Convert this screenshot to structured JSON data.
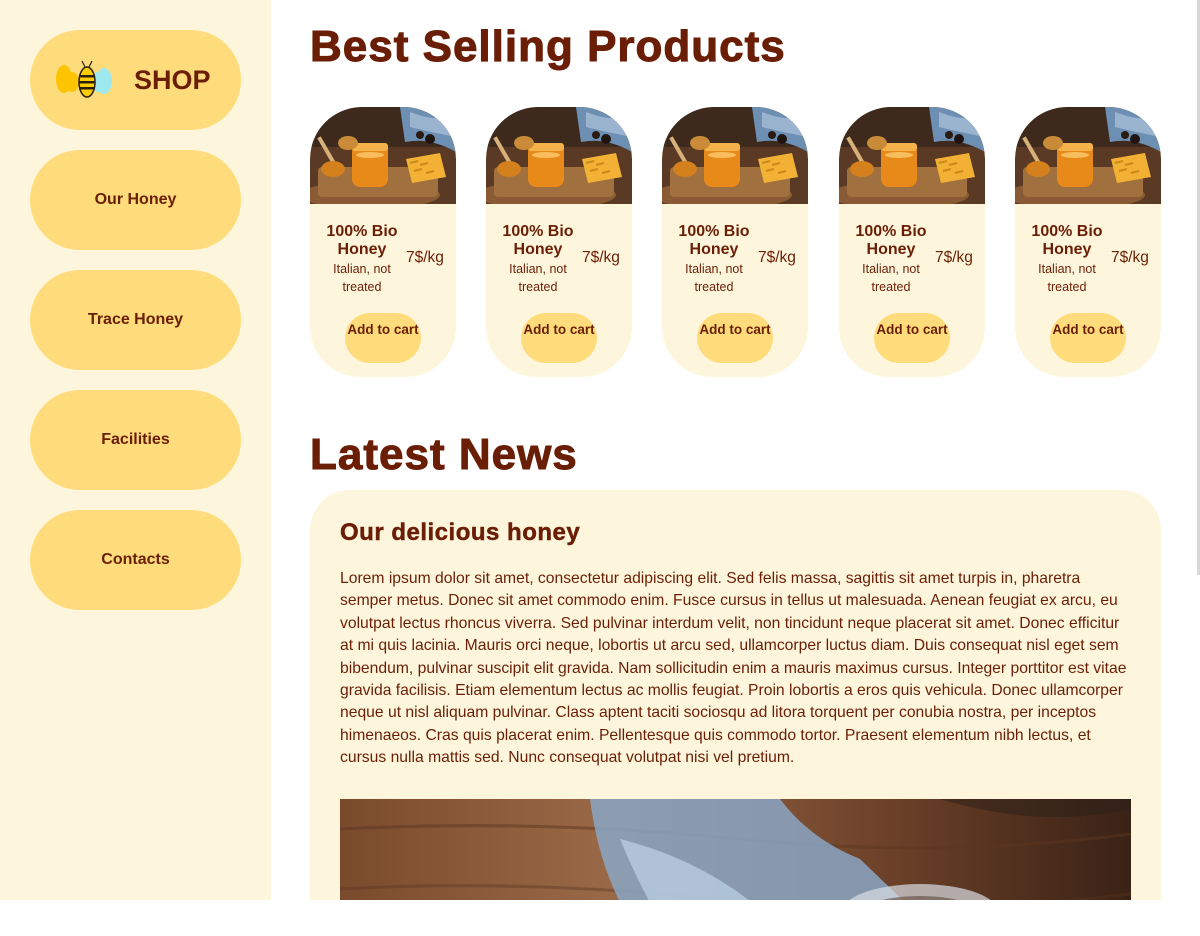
{
  "sidebar": {
    "logo_text": "SHOP",
    "items": [
      {
        "label": "Our Honey"
      },
      {
        "label": "Trace Honey"
      },
      {
        "label": "Facilities"
      },
      {
        "label": "Contacts"
      }
    ]
  },
  "best_selling": {
    "title": "Best Selling Products",
    "products": [
      {
        "name": "100% Bio Honey",
        "subtitle": "Italian, not treated",
        "price": "7$/kg",
        "button": "Add to cart"
      },
      {
        "name": "100% Bio Honey",
        "subtitle": "Italian, not treated",
        "price": "7$/kg",
        "button": "Add to cart"
      },
      {
        "name": "100% Bio Honey",
        "subtitle": "Italian, not treated",
        "price": "7$/kg",
        "button": "Add to cart"
      },
      {
        "name": "100% Bio Honey",
        "subtitle": "Italian, not treated",
        "price": "7$/kg",
        "button": "Add to cart"
      },
      {
        "name": "100% Bio Honey",
        "subtitle": "Italian, not treated",
        "price": "7$/kg",
        "button": "Add to cart"
      }
    ]
  },
  "news": {
    "title": "Latest News",
    "article": {
      "heading": "Our delicious honey",
      "body": "Lorem ipsum dolor sit amet, consectetur adipiscing elit. Sed felis massa, sagittis sit amet turpis in, pharetra semper metus. Donec sit amet commodo enim. Fusce cursus in tellus ut malesuada. Aenean feugiat ex arcu, eu volutpat lectus rhoncus viverra. Sed pulvinar interdum velit, non tincidunt neque placerat sit amet. Donec efficitur at mi quis lacinia. Mauris orci neque, lobortis ut arcu sed, ullamcorper luctus diam. Duis consequat nisl eget sem bibendum, pulvinar suscipit elit gravida. Nam sollicitudin enim a mauris maximus cursus. Integer porttitor est vitae gravida facilisis. Etiam elementum lectus ac mollis feugiat. Proin lobortis a eros quis vehicula. Donec ullamcorper neque ut nisl aliquam pulvinar. Class aptent taciti sociosqu ad litora torquent per conubia nostra, per inceptos himenaeos. Cras quis placerat enim. Pellentesque quis commodo tortor. Praesent elementum nibh lectus, et cursus nulla mattis sed. Nunc consequat volutpat nisi vel pretium."
    }
  },
  "icons": {
    "logo": "bee-icon",
    "product_image": "honey-jar-image",
    "news_image": "honey-jar-closeup-image"
  },
  "colors": {
    "brand_text": "#6b1e06",
    "accent_yellow": "#ffdc7b",
    "panel_cream": "#fdf6dd"
  }
}
